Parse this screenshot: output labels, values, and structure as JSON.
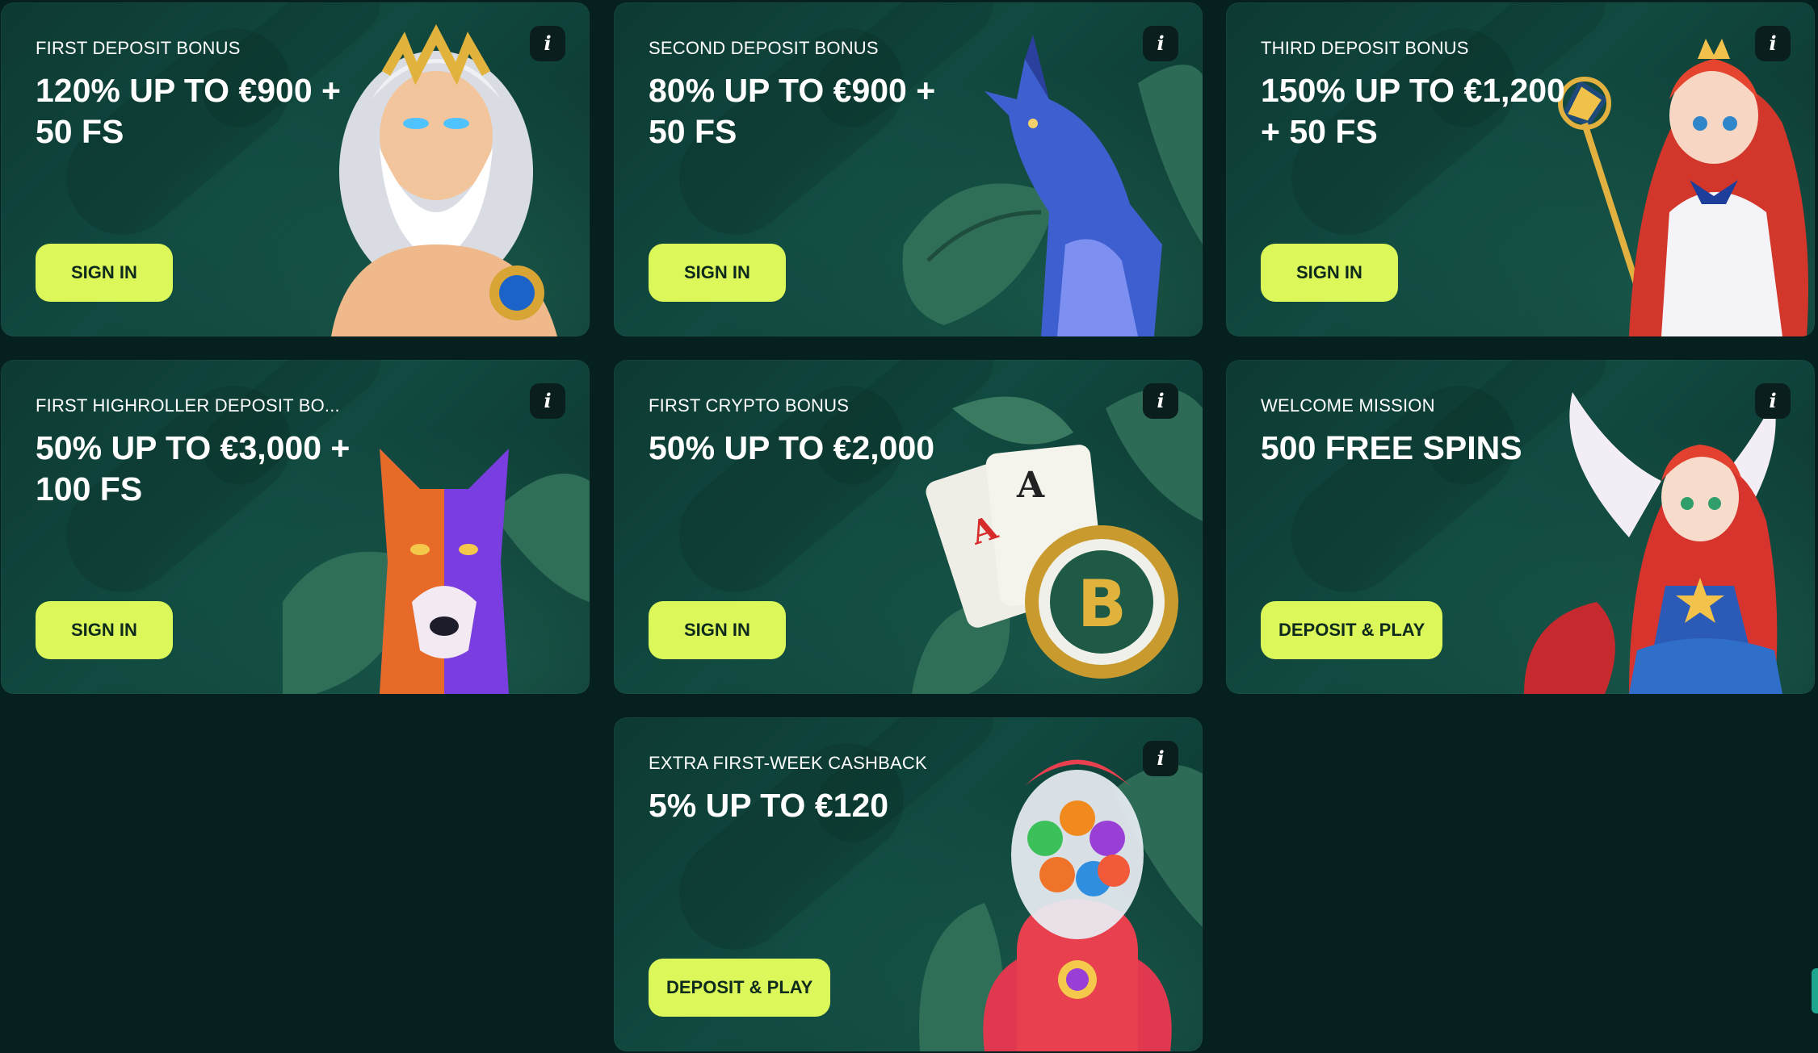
{
  "colors": {
    "background": "#062020",
    "card": "#114a40",
    "button": "#dcf75a",
    "button_text": "#0d2a1c",
    "info_bg": "#0a1f1d"
  },
  "info_icon_glyph": "i",
  "cards": [
    {
      "label": "FIRST DEPOSIT BONUS",
      "title": "120% UP TO €900 + 50 FS",
      "button": "SIGN IN",
      "art": "zeus-character-icon"
    },
    {
      "label": "SECOND DEPOSIT BONUS",
      "title": "80% UP TO €900 + 50 FS",
      "button": "SIGN IN",
      "art": "howling-wolf-icon"
    },
    {
      "label": "THIRD DEPOSIT BONUS",
      "title": "150% UP TO €1,200 + 50 FS",
      "button": "SIGN IN",
      "art": "anime-princess-icon"
    },
    {
      "label": "FIRST HIGHROLLER DEPOSIT BO...",
      "title": "50% UP TO €3,000 + 100 FS",
      "button": "SIGN IN",
      "art": "colorful-wolf-icon"
    },
    {
      "label": "FIRST CRYPTO BONUS",
      "title": "50% UP TO €2,000",
      "button": "SIGN IN",
      "art": "cards-bitcoin-chip-icon"
    },
    {
      "label": "WELCOME MISSION",
      "title": "500 FREE SPINS",
      "button": "DEPOSIT & PLAY",
      "art": "winged-heroine-icon"
    },
    {
      "label": "EXTRA FIRST-WEEK CASHBACK",
      "title": "5% UP TO €120",
      "button": "DEPOSIT & PLAY",
      "art": "gumball-rocket-icon"
    }
  ]
}
